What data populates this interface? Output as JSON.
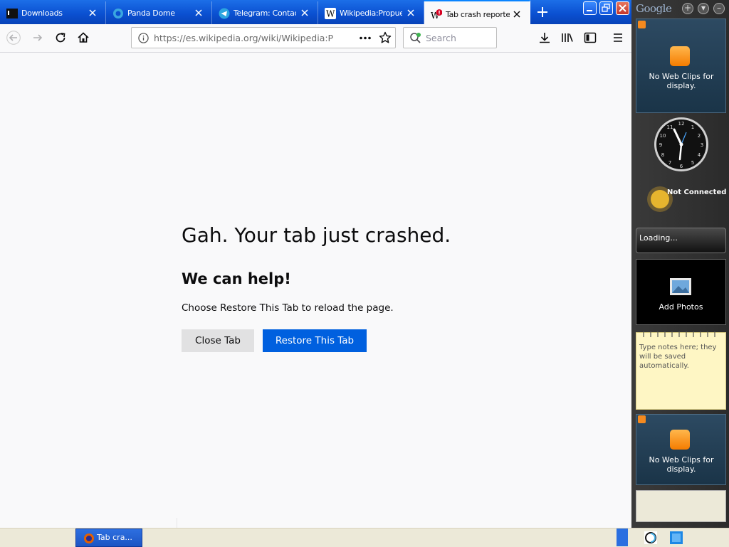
{
  "tabs": [
    {
      "label": "Downloads",
      "icon": "terminal-icon",
      "active": false
    },
    {
      "label": "Panda Dome",
      "icon": "panda-icon",
      "active": false
    },
    {
      "label": "Telegram: Contact",
      "icon": "telegram-icon",
      "active": false
    },
    {
      "label": "Wikipedia:Propuesta",
      "icon": "wikipedia-icon",
      "active": false
    },
    {
      "label": "Tab crash reporter",
      "icon": "wikipedia-crash-icon",
      "active": true
    }
  ],
  "navbar": {
    "url": "https://es.wikipedia.org/wiki/Wikipedia:Propuestas",
    "search_placeholder": "Search"
  },
  "crash_page": {
    "title": "Gah. Your tab just crashed.",
    "subtitle": "We can help!",
    "description": "Choose Restore This Tab to reload the page.",
    "close_button": "Close Tab",
    "restore_button": "Restore This Tab"
  },
  "sidebar": {
    "logo": "Google",
    "web_clips_1": "No Web Clips for display.",
    "weather_status": "Not Connected",
    "news_text": "Loading...",
    "photos_label": "Add Photos",
    "notes_placeholder": "Type notes here; they will be saved automatically.",
    "web_clips_2": "No Web Clips for display."
  },
  "taskbar": {
    "task_label": "Tab cra..."
  },
  "colors": {
    "tabstrip": "#0a4fd0",
    "primary_button": "#0060df",
    "secondary_button": "#e1e1e2",
    "page_background": "#f9f9fa"
  }
}
